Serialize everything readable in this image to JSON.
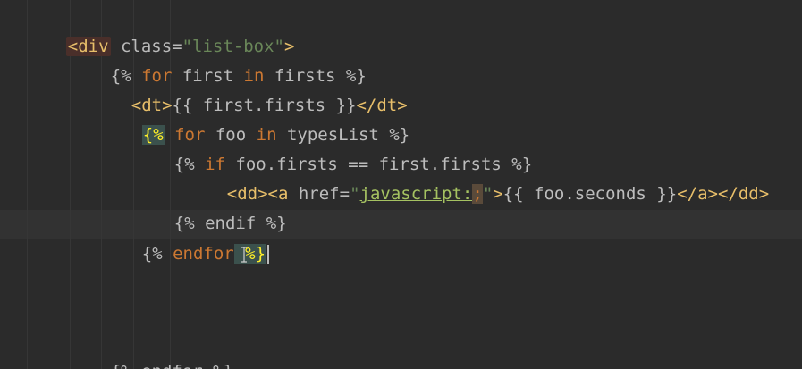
{
  "code": {
    "line1": {
      "open": "<div",
      "attr": " class=",
      "value": "\"list-box\"",
      "close": ">"
    },
    "line2": {
      "open": "{% ",
      "kw1": "for",
      "mid": " first ",
      "kw2": "in",
      "end": " firsts %}"
    },
    "line3": {
      "open_tag": "<dt>",
      "expr": "{{ first.firsts }}",
      "close_tag": "</dt>"
    },
    "line4": {
      "open": "{%",
      "kw1": " for",
      "mid": " foo ",
      "kw2": "in",
      "end": " typesList %}"
    },
    "line5": {
      "open": "{% ",
      "kw": "if",
      "end": " foo.firsts == first.firsts %}"
    },
    "line6": {
      "dd_open": "<dd>",
      "a_open": "<a",
      "attr": " href=",
      "q1": "\"",
      "link": "javascript:",
      "semi": ";",
      "q2": "\"",
      "gt": ">",
      "expr": "{{ foo.seconds }}",
      "a_close": "</a>",
      "dd_close": "</dd>"
    },
    "line7": {
      "text": "{% endif %}"
    },
    "line8": {
      "open": "{% ",
      "kw": "endfor",
      "close": " %}"
    },
    "line12": {
      "text": "{% endfor %}"
    }
  }
}
